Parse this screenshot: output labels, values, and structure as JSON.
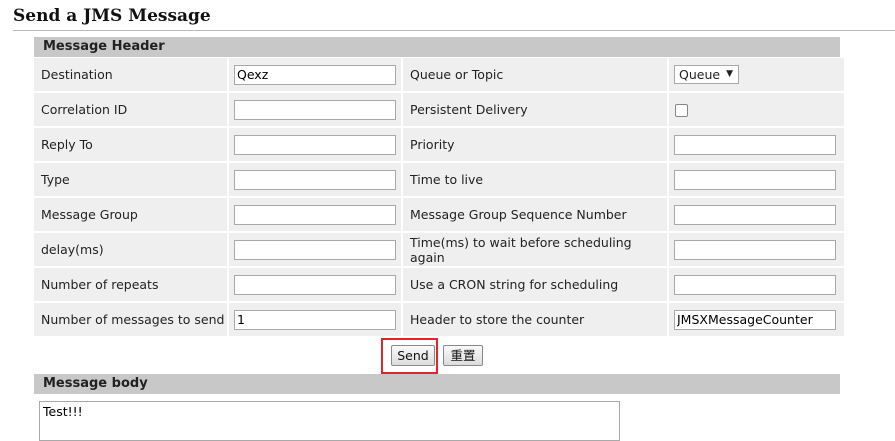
{
  "page": {
    "title": "Send a JMS Message"
  },
  "header_section": {
    "title": "Message Header"
  },
  "rows": [
    {
      "label1": "Destination",
      "value1": "Qexz",
      "label2": "Queue or Topic",
      "select_value": "Queue"
    },
    {
      "label1": "Correlation ID",
      "value1": "",
      "label2": "Persistent Delivery",
      "checked": false
    },
    {
      "label1": "Reply To",
      "value1": "",
      "label2": "Priority",
      "value2": ""
    },
    {
      "label1": "Type",
      "value1": "",
      "label2": "Time to live",
      "value2": ""
    },
    {
      "label1": "Message Group",
      "value1": "",
      "label2": "Message Group Sequence Number",
      "value2": ""
    },
    {
      "label1": "delay(ms)",
      "value1": "",
      "label2": "Time(ms) to wait before scheduling again",
      "value2": ""
    },
    {
      "label1": "Number of repeats",
      "value1": "",
      "label2": "Use a CRON string for scheduling",
      "value2": ""
    },
    {
      "label1": "Number of messages to send",
      "value1": "1",
      "label2": "Header to store the counter",
      "value2": "JMSXMessageCounter"
    }
  ],
  "buttons": {
    "send": "Send",
    "reset": "重置"
  },
  "body_section": {
    "title": "Message body",
    "content": "Test!!!"
  },
  "colors": {
    "highlight": "#e0262a",
    "section_bg": "#c8c8c8",
    "row_bg": "#efefef"
  }
}
